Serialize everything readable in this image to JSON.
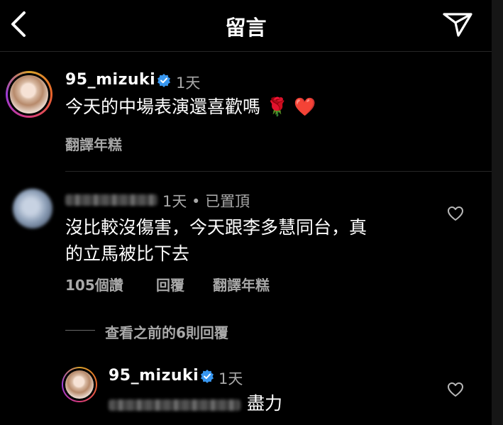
{
  "header": {
    "title": "留言"
  },
  "caption": {
    "username": "95_mizuki",
    "time": "1天",
    "text": "今天的中場表演還喜歡嗎",
    "emoji_rose": "🌹",
    "emoji_heart": "❤️",
    "translate": "翻譯年糕"
  },
  "comment": {
    "time_pinned": "1天 • 已置頂",
    "line1": "沒比較沒傷害，今天跟李多慧同台，真",
    "line2": "的立馬被比下去",
    "likes": "105個讚",
    "reply": "回覆",
    "translate": "翻譯年糕",
    "view_replies": "查看之前的6則回覆"
  },
  "reply": {
    "username": "95_mizuki",
    "time": "1天",
    "text": "盡力"
  },
  "colors": {
    "accent_verified": "#3897f0",
    "heart_red": "#e0245e",
    "muted": "#a8a8a8"
  }
}
